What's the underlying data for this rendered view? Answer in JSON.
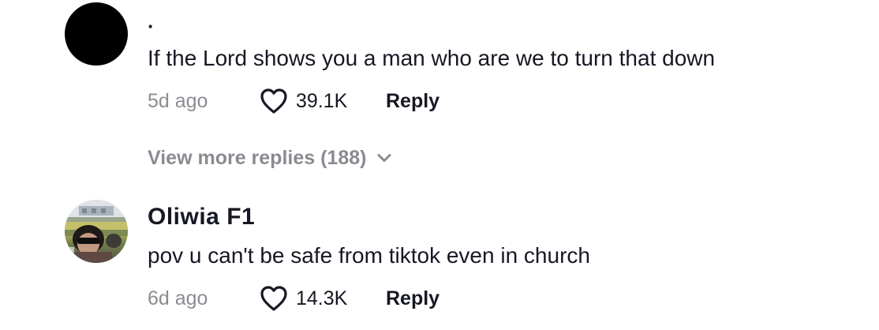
{
  "comments": [
    {
      "username": "·",
      "text": "If the Lord shows you a man who are we to turn that down",
      "time": "5d ago",
      "likes": "39.1K",
      "reply_label": "Reply",
      "avatar": "black-circle-avatar"
    },
    {
      "username": "Oliwia F1",
      "text": "pov u can't be safe from tiktok even in church",
      "time": "6d ago",
      "likes": "14.3K",
      "reply_label": "Reply",
      "avatar": "photo-avatar"
    }
  ],
  "view_more": {
    "label": "View more replies (188)",
    "icon": "chevron-down-icon"
  },
  "colors": {
    "text": "#161823",
    "muted": "#8a8b91",
    "background": "#ffffff"
  }
}
